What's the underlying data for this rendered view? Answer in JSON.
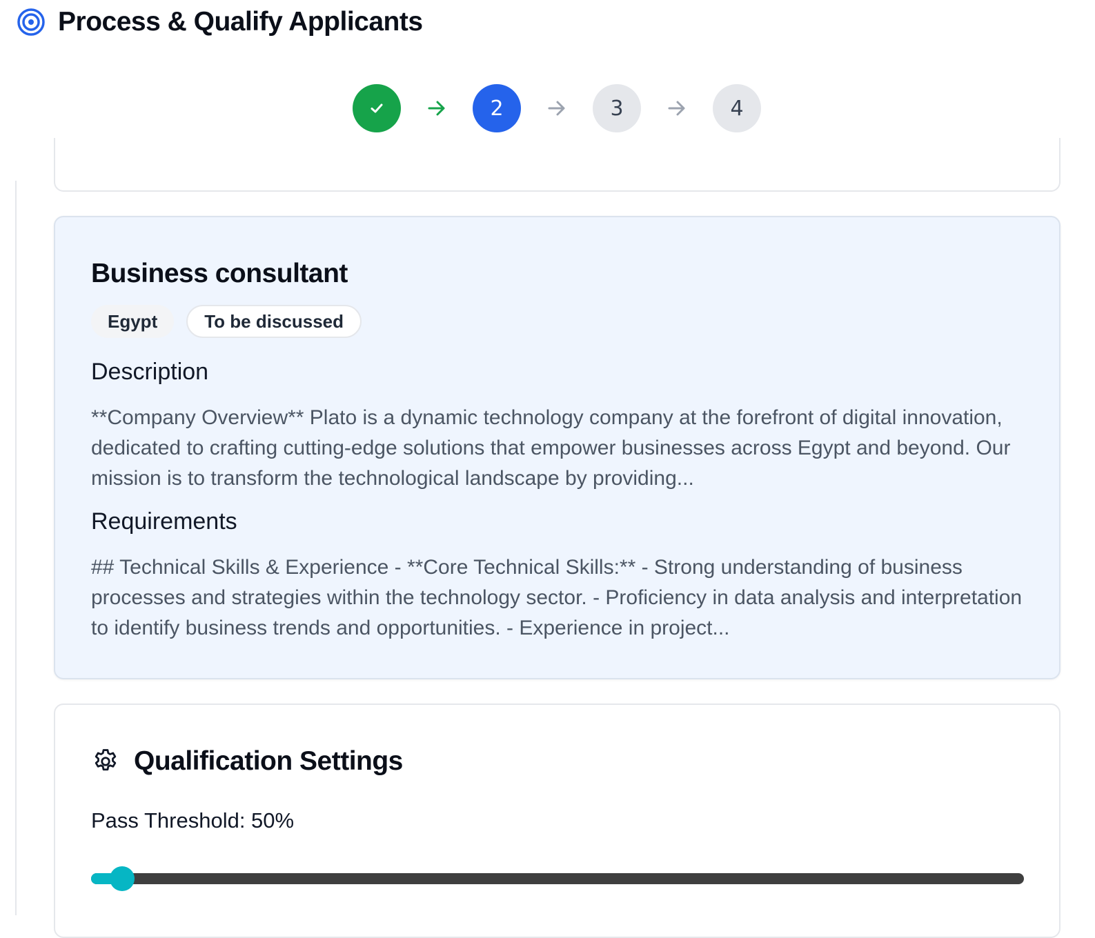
{
  "header": {
    "title": "Process & Qualify Applicants",
    "icon": "target-icon"
  },
  "stepper": {
    "steps": [
      {
        "label": "",
        "state": "completed",
        "icon": "check-icon"
      },
      {
        "label": "2",
        "state": "current"
      },
      {
        "label": "3",
        "state": "upcoming"
      },
      {
        "label": "4",
        "state": "upcoming"
      }
    ],
    "colors": {
      "completed": "#16a34a",
      "current": "#2563eb",
      "upcoming": "#e5e7eb"
    }
  },
  "job": {
    "title": "Business consultant",
    "tags": [
      "Egypt",
      "To be discussed"
    ],
    "description_heading": "Description",
    "description": "**Company Overview** Plato is a dynamic technology company at the forefront of digital innovation, dedicated to crafting cutting-edge solutions that empower businesses across Egypt and beyond. Our mission is to transform the technological landscape by providing...",
    "requirements_heading": "Requirements",
    "requirements": "## Technical Skills & Experience - **Core Technical Skills:** - Strong understanding of business processes and strategies within the technology sector. - Proficiency in data analysis and interpretation to identify business trends and opportunities. - Experience in project..."
  },
  "settings": {
    "title": "Qualification Settings",
    "icon": "gear-icon",
    "threshold_label": "Pass Threshold: 50%",
    "slider_fraction": 0.033,
    "accent": "#06b6c4"
  }
}
